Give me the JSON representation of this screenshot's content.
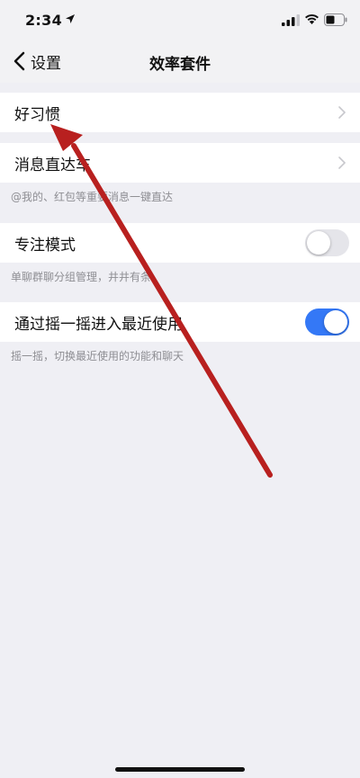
{
  "status_bar": {
    "time": "2:34",
    "icons": [
      "location-arrow-icon",
      "signal-icon",
      "wifi-icon",
      "battery-icon"
    ]
  },
  "nav": {
    "back_label": "设置",
    "title": "效率套件"
  },
  "items": [
    {
      "label": "好习惯",
      "control": "chevron"
    },
    {
      "label": "消息直达车",
      "control": "chevron",
      "description": "@我的、红包等重要消息一键直达"
    },
    {
      "label": "专注模式",
      "control": "toggle",
      "toggle_on": false,
      "description": "单聊群聊分组管理，井井有条"
    },
    {
      "label": "通过摇一摇进入最近使用",
      "control": "toggle",
      "toggle_on": true,
      "description": "摇一摇，切换最近使用的功能和聊天"
    }
  ],
  "colors": {
    "background": "#efeff4",
    "toggle_on": "#3478f6",
    "toggle_off": "#e5e5ea",
    "annotation_arrow": "#b8201f"
  }
}
